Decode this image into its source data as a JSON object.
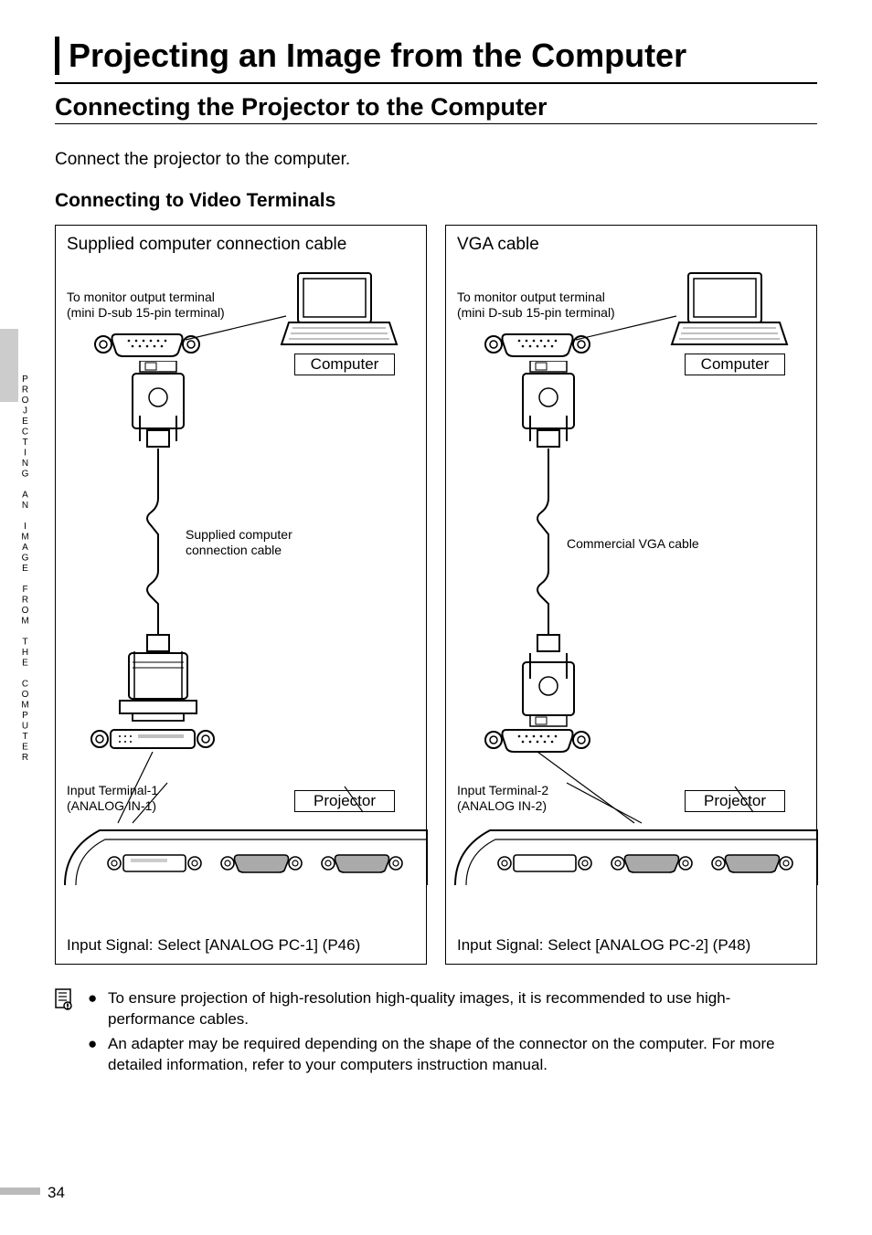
{
  "side_tab_label": "PROJECTING AN IMAGE FROM THE COMPUTER",
  "title": "Projecting an Image from the Computer",
  "subtitle": "Connecting the Projector to the Computer",
  "intro": "Connect the projector to the computer.",
  "section_heading": "Connecting to Video Terminals",
  "left_panel": {
    "title": "Supplied computer connection cable",
    "monitor_line1": "To monitor output terminal",
    "monitor_line2": "(mini D-sub 15-pin terminal)",
    "computer_label": "Computer",
    "cable_line1": "Supplied computer",
    "cable_line2": "connection cable",
    "input_term_line1": "Input Terminal-1",
    "input_term_line2": "(ANALOG IN-1)",
    "projector_label": "Projector",
    "signal": "Input Signal: Select [ANALOG PC-1] (P46)"
  },
  "right_panel": {
    "title": "VGA cable",
    "monitor_line1": "To monitor output terminal",
    "monitor_line2": "(mini D-sub 15-pin terminal)",
    "computer_label": "Computer",
    "cable_line1": "Commercial VGA cable",
    "input_term_line1": "Input Terminal-2",
    "input_term_line2": "(ANALOG IN-2)",
    "projector_label": "Projector",
    "signal": "Input Signal: Select [ANALOG PC-2] (P48)"
  },
  "notes": {
    "b1": "To ensure projection of high-resolution high-quality images, it is recommended to use high-performance cables.",
    "b2": "An adapter may be required depending on the shape of the connector on the computer. For more detailed information, refer to your computers instruction manual."
  },
  "page_number": "34"
}
